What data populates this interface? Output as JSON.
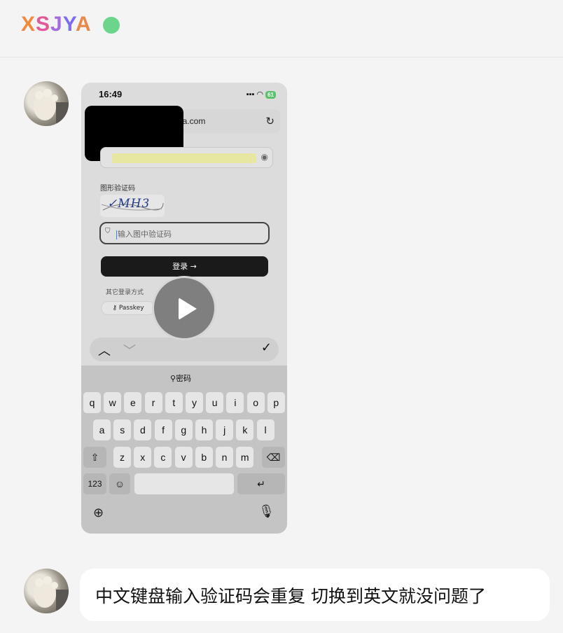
{
  "header": {
    "brand_letters": [
      "X",
      "S",
      "J",
      "Y",
      "A"
    ],
    "status": "online"
  },
  "messages": [
    {
      "type": "video",
      "video": {
        "phone_time": "16:49",
        "battery": "61",
        "url_fragment": "ga.com",
        "captcha_label": "图形验证码",
        "captcha_text": "✓MH3",
        "code_placeholder": "输入图中验证码",
        "login_button": "登录 →",
        "other_login_label": "其它登录方式",
        "passkey_button": "Passkey",
        "keyboard_suggestion": "密码",
        "keyboard_rows": [
          [
            "q",
            "w",
            "e",
            "r",
            "t",
            "y",
            "u",
            "i",
            "o",
            "p"
          ],
          [
            "a",
            "s",
            "d",
            "f",
            "g",
            "h",
            "j",
            "k",
            "l"
          ],
          [
            "z",
            "x",
            "c",
            "v",
            "b",
            "n",
            "m"
          ]
        ],
        "numbers_key": "123"
      }
    },
    {
      "type": "text",
      "text": "中文键盘输入验证码会重复  切换到英文就没问题了"
    }
  ]
}
